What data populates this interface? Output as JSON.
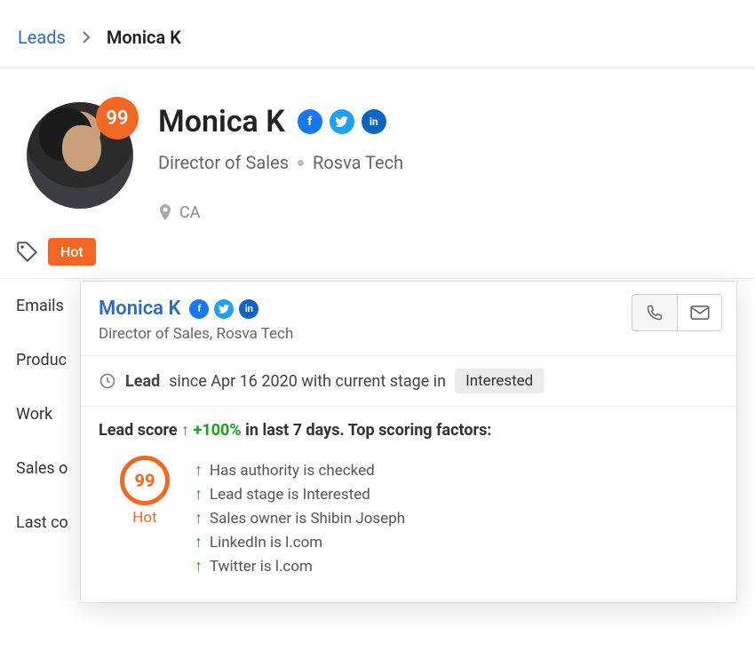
{
  "breadcrumb": {
    "root": "Leads",
    "current": "Monica K"
  },
  "lead": {
    "name": "Monica K",
    "title": "Director of Sales",
    "company": "Rosva Tech",
    "location": "CA",
    "score": "99",
    "hot_tag": "Hot"
  },
  "fields": {
    "emails": "Emails",
    "product": "Produc",
    "work": "Work",
    "sales": "Sales o",
    "last": "Last co"
  },
  "popup": {
    "name": "Monica K",
    "subtitle": "Director of Sales, Rosva Tech",
    "icons": {
      "fb": "facebook-icon",
      "tw": "twitter-icon",
      "li": "linkedin-icon"
    },
    "status_prefix": "Lead",
    "status_mid": "since Apr 16 2020 with current stage in",
    "stage": "Interested",
    "score_label": "Lead score",
    "delta": "+100%",
    "delta_suffix": "in last 7 days. Top scoring factors:",
    "ring_value": "99",
    "ring_label": "Hot",
    "factors": [
      "Has authority is checked",
      "Lead stage is Interested",
      "Sales owner is Shibin Joseph",
      "LinkedIn is l.com",
      "Twitter is l.com"
    ]
  }
}
